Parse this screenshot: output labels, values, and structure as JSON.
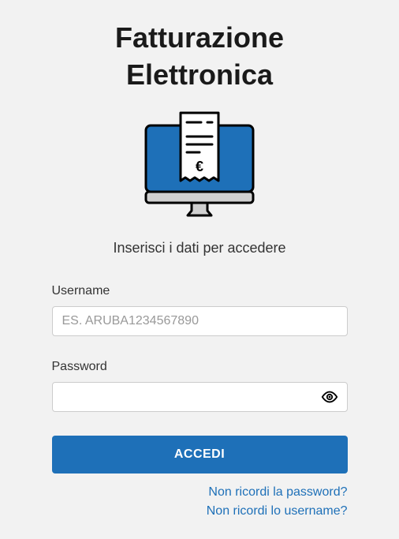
{
  "title_line1": "Fatturazione",
  "title_line2": "Elettronica",
  "subtitle": "Inserisci i dati per accedere",
  "form": {
    "username_label": "Username",
    "username_placeholder": "ES. ARUBA1234567890",
    "username_value": "",
    "password_label": "Password",
    "password_value": "",
    "submit_label": "ACCEDI"
  },
  "links": {
    "forgot_password": "Non ricordi la password?",
    "forgot_username": "Non ricordi lo username?"
  }
}
